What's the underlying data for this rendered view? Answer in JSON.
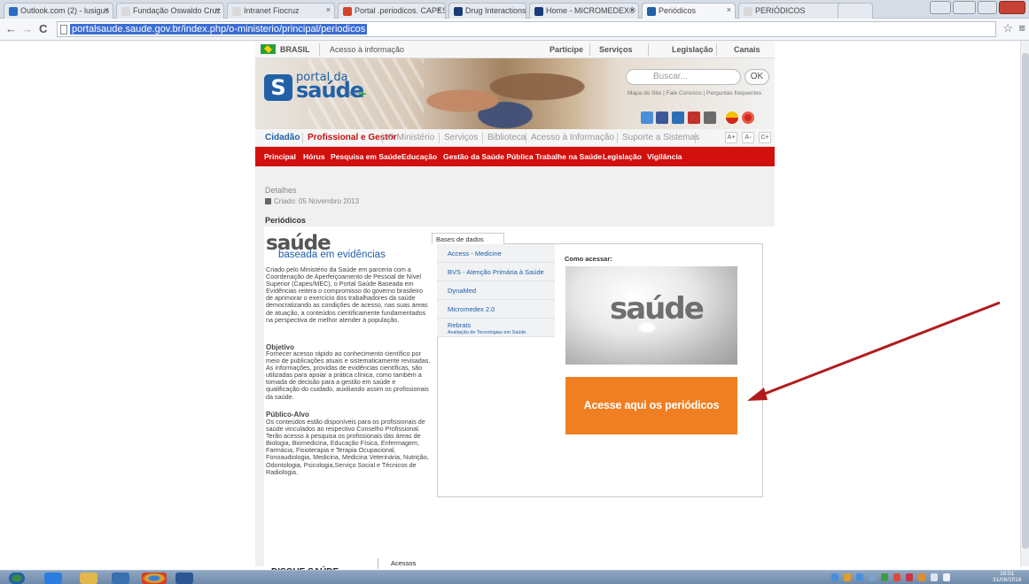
{
  "browser": {
    "tabs": [
      {
        "label": "Outlook.com (2) - lusigus",
        "color": "#2b6cc4"
      },
      {
        "label": "Fundação Oswaldo Cruz",
        "color": "#d9d9d9"
      },
      {
        "label": "Intranet Fiocruz",
        "color": "#d9d9d9"
      },
      {
        "label": "Portal .periodicos. CAPES",
        "color": "#d4442a"
      },
      {
        "label": "Drug Interactions results",
        "color": "#1a3c7a"
      },
      {
        "label": "Home - MICROMEDEX®",
        "color": "#1a3c7a"
      },
      {
        "label": "Periódicos",
        "color": "#2261a8"
      },
      {
        "label": "PERIÓDICOS",
        "color": "#d9d9d9"
      }
    ],
    "close_glyph": "×",
    "url": "portalsaude.saude.gov.br/index.php/o-ministerio/principal/periodicos",
    "back": "←",
    "forward": "→",
    "reload": "C",
    "star": "☆",
    "menu": "≡"
  },
  "govbar": {
    "brasil": "BRASIL",
    "acesso": "Acesso à informação",
    "participe": "Participe",
    "servicos": "Serviços",
    "legislacao": "Legislação",
    "canais": "Canais"
  },
  "header": {
    "logo_s": "S",
    "logo_portal": "portal da",
    "logo_saude": "saúde",
    "logo_sus": "SUS",
    "logo_plus": "+",
    "search_placeholder": "Buscar...",
    "ok": "OK",
    "top_links": "Mapa do Site  |  Fale Conosco  |  Perguntas frequentes"
  },
  "mainnav": {
    "cidadao": "Cidadão",
    "profissional": "Profissional e Gestor",
    "ministerio": "O Ministério",
    "servicos": "Serviços",
    "biblioteca": "Biblioteca",
    "acesso": "Acesso à Informação",
    "suporte": "Suporte a Sistemas",
    "font_plus": "A+",
    "font_minus": "A-",
    "contrast": "C+"
  },
  "rednav": [
    "Principal",
    "Hórus",
    "Pesquisa em Saúde",
    "Educação",
    "Gestão da Saúde Pública",
    "Trabalhe na Saúde",
    "Legislação",
    "Vigilância"
  ],
  "article": {
    "details": "Detalhes",
    "created": "Criado: 05 Novembro 2013",
    "title": "Periódicos"
  },
  "sbe": {
    "logo_title": "saúde",
    "logo_subtitle": "baseada em evidências",
    "intro": "Criado pelo Ministério da Saúde em parceria com a Coordenação de Aperfeiçoamento de Pessoal de Nível Superior (Capes/MEC), o Portal Saúde Baseada em Evidências reitera o compromisso do governo brasileiro de aprimorar o exercício dos trabalhadores da saúde democratizando as condições de acesso, nas suas áreas de atuação, a conteúdos cientificamente fundamentados na perspectiva de melhor atender à população.",
    "objetivo_title": "Objetivo",
    "objetivo": "Fornecer acesso rápido ao conhecimento científico por meio de publicações atuais e sistematicamente revisadas. As informações, providas de evidências científicas, são utilizadas para apoiar a prática clínica, como também a tomada de decisão para a gestão em saúde e qualificação do cuidado, auxiliando assim os profissionais da saúde.",
    "publico_title": "Público-Alvo",
    "publico": "Os conteúdos estão disponíveis para os profissionais de saúde vinculados ao respectivo Conselho Profissional. Terão acesso à pesquisa os profissionais das áreas de Biologia, Biomedicina, Educação Física, Enfermagem, Farmácia, Fisioterapia e Terapia Ocupacional, Fonoaudiologia, Medicina, Medicina Veterinária, Nutrição, Odontologia, Psicologia,Serviço Social e Técnicos de Radiologia."
  },
  "databases": {
    "tab_label": "Bases de dados",
    "items": [
      {
        "label": "Access - Medicine",
        "sub": ""
      },
      {
        "label": "BVS - Atenção Primária à Saúde",
        "sub": ""
      },
      {
        "label": "DynaMed",
        "sub": ""
      },
      {
        "label": "Micromedex 2.0",
        "sub": ""
      },
      {
        "label": "Rebrats",
        "sub": "Avaliação de Tecnologias em Saúde"
      }
    ],
    "como_acessar": "Como acessar:",
    "image_word": "saúde",
    "cta": "Acesse aqui os periódicos",
    "cta_color": "#f07f22",
    "arrow_color": "#b01c1c"
  },
  "footer": {
    "disque": "DISQUE SAÚDE",
    "acessos": "Acessos"
  },
  "taskbar": {
    "time": "16:51",
    "date": "31/08/2016"
  }
}
